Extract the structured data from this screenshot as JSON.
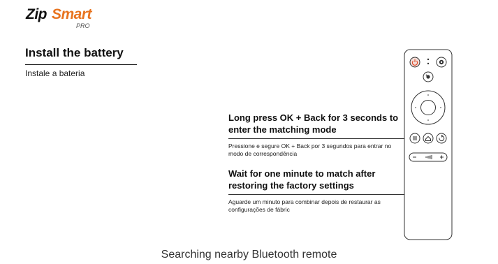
{
  "brand": {
    "part1": "Zip",
    "part2": "Smart",
    "part3": "PRO"
  },
  "section": {
    "title": "Install the battery",
    "subtitle": "Instale a bateria"
  },
  "steps": [
    {
      "title": "Long press OK + Back for 3 seconds to enter the matching mode",
      "description": "Pressione e segure OK + Back por 3 segundos para entrar no modo de correspondência"
    },
    {
      "title": "Wait for one minute to match after restoring the factory settings",
      "description": "Aguarde um minuto para combinar depois de restaurar as configurações de fábric"
    }
  ],
  "remote": {
    "buttons": [
      "power-button",
      "settings-button",
      "google-assistant-button",
      "dpad",
      "ok-button",
      "menu-button",
      "home-button",
      "back-button",
      "volume-rocker"
    ],
    "colors": {
      "power": "#e04b2a",
      "outline": "#333333"
    }
  },
  "status": {
    "text": "Searching nearby Bluetooth remote"
  }
}
